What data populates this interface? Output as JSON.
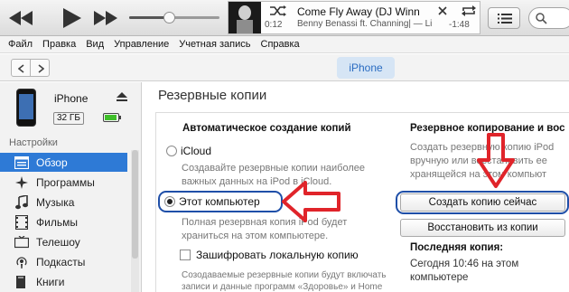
{
  "player": {
    "now_playing": {
      "title": "Come Fly Away (DJ Winn",
      "artist": "Benny Benassi ft. Channing| — Li",
      "elapsed": "0:12",
      "remaining": "-1:48"
    },
    "volume_percent": 55,
    "icons": [
      "rewind-icon",
      "play-icon",
      "fast-forward-icon",
      "shuffle-icon",
      "repeat-icon",
      "list-icon",
      "search-icon"
    ]
  },
  "menu": {
    "items": [
      "Файл",
      "Правка",
      "Вид",
      "Управление",
      "Учетная запись",
      "Справка"
    ]
  },
  "nav": {
    "device_tab": "iPhone"
  },
  "sidebar": {
    "device": {
      "name": "iPhone",
      "capacity": "32 ГБ",
      "battery_percent": 80
    },
    "section_label": "Настройки",
    "items": [
      {
        "label": "Обзор",
        "icon": "summary-icon",
        "active": true
      },
      {
        "label": "Программы",
        "icon": "apps-icon",
        "active": false
      },
      {
        "label": "Музыка",
        "icon": "music-icon",
        "active": false
      },
      {
        "label": "Фильмы",
        "icon": "film-icon",
        "active": false
      },
      {
        "label": "Телешоу",
        "icon": "tv-icon",
        "active": false
      },
      {
        "label": "Подкасты",
        "icon": "podcast-icon",
        "active": false
      },
      {
        "label": "Книги",
        "icon": "book-icon",
        "active": false
      }
    ]
  },
  "main": {
    "title": "Резервные копии",
    "auto_backup": {
      "heading": "Автоматическое создание копий",
      "icloud_label": "iCloud",
      "icloud_desc_1": "Создавайте резервные копии наиболее",
      "icloud_desc_2": "важных данных на iPod в iCloud.",
      "computer_label": "Этот компьютер",
      "computer_desc_1": "Полная резервная копия iPod будет",
      "computer_desc_2": "храниться на этом компьютере.",
      "encrypt_label": "Зашифровать локальную копию",
      "encrypt_desc_1": "Созодаваемые резервные копии будут включать",
      "encrypt_desc_2": "записи и данные программ «Здоровье» и Home",
      "selected": "computer"
    },
    "manual_backup": {
      "heading": "Резервное копирование и вос",
      "desc_1": "Создать резервную копию iPod",
      "desc_2": "вручную или восстановить ее",
      "desc_3": "хранящейся на этом компьют",
      "backup_now_label": "Создать копию сейчас",
      "restore_label": "Восстановить из копии",
      "last_backup_heading": "Последняя копия:",
      "last_backup_value": "Сегодня 10:46 на этом компьютере"
    }
  },
  "colors": {
    "accent": "#2e7ad6",
    "annotation_red": "#e0242a",
    "highlight_blue": "#1f4fa8"
  }
}
